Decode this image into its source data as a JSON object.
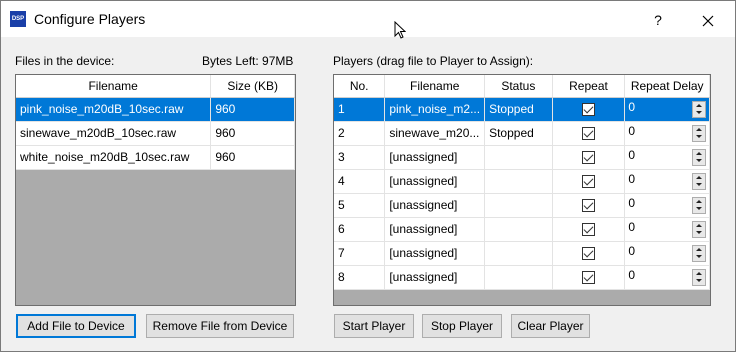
{
  "window": {
    "title": "Configure Players",
    "icon_text": "DSP",
    "help_label": "?"
  },
  "files": {
    "section_label": "Files in the device:",
    "bytes_left": "Bytes Left: 97MB",
    "columns": [
      "Filename",
      "Size (KB)"
    ],
    "rows": [
      {
        "filename": "pink_noise_m20dB_10sec.raw",
        "size": "960",
        "selected": true
      },
      {
        "filename": "sinewave_m20dB_10sec.raw",
        "size": "960",
        "selected": false
      },
      {
        "filename": "white_noise_m20dB_10sec.raw",
        "size": "960",
        "selected": false
      }
    ],
    "add_button": "Add File to Device",
    "remove_button": "Remove File from Device"
  },
  "players": {
    "section_label": "Players (drag file to Player to Assign):",
    "columns": [
      "No.",
      "Filename",
      "Status",
      "Repeat",
      "Repeat Delay"
    ],
    "rows": [
      {
        "no": "1",
        "filename": "pink_noise_m2...",
        "status": "Stopped",
        "repeat": true,
        "delay": "0",
        "selected": true
      },
      {
        "no": "2",
        "filename": "sinewave_m20...",
        "status": "Stopped",
        "repeat": true,
        "delay": "0",
        "selected": false
      },
      {
        "no": "3",
        "filename": "[unassigned]",
        "status": "",
        "repeat": true,
        "delay": "0",
        "selected": false
      },
      {
        "no": "4",
        "filename": "[unassigned]",
        "status": "",
        "repeat": true,
        "delay": "0",
        "selected": false
      },
      {
        "no": "5",
        "filename": "[unassigned]",
        "status": "",
        "repeat": true,
        "delay": "0",
        "selected": false
      },
      {
        "no": "6",
        "filename": "[unassigned]",
        "status": "",
        "repeat": true,
        "delay": "0",
        "selected": false
      },
      {
        "no": "7",
        "filename": "[unassigned]",
        "status": "",
        "repeat": true,
        "delay": "0",
        "selected": false
      },
      {
        "no": "8",
        "filename": "[unassigned]",
        "status": "",
        "repeat": true,
        "delay": "0",
        "selected": false
      }
    ],
    "start_button": "Start Player",
    "stop_button": "Stop Player",
    "clear_button": "Clear Player"
  },
  "colors": {
    "selection": "#0078d7",
    "empty_grid": "#ababab"
  }
}
